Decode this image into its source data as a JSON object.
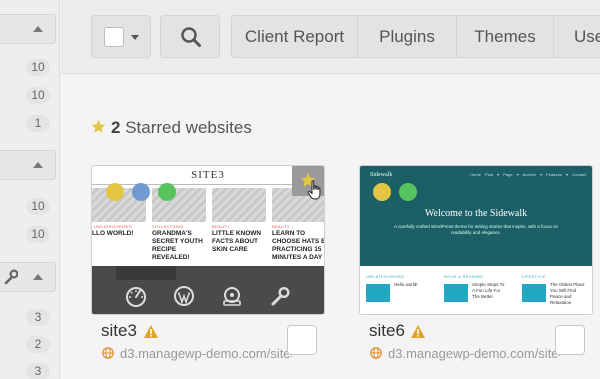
{
  "sidebar": {
    "groups": [
      {
        "counts": [
          "10",
          "10",
          "1"
        ]
      },
      {
        "counts": [
          "10",
          "10"
        ]
      },
      {
        "counts": [
          "3",
          "2",
          "3"
        ]
      }
    ]
  },
  "toolbar": {
    "client_report_label": "Client Report",
    "plugins_label": "Plugins",
    "themes_label": "Themes",
    "users_label": "Use"
  },
  "starred": {
    "count": "2",
    "label": "Starred websites"
  },
  "sites": [
    {
      "name": "site3",
      "url": "d3.managewp-demo.com/site3",
      "thumbnail": {
        "title": "SITE3",
        "posts": [
          {
            "category": "UNCATEGORIZED",
            "title": "LLO WORLD!"
          },
          {
            "category": "COLLECTIONS",
            "title": "GRANDMA'S SECRET YOUTH RECIPE REVEALED!"
          },
          {
            "category": "BEAUTY",
            "title": "LITTLE KNOWN FACTS ABOUT SKIN CARE"
          },
          {
            "category": "BEAUTY",
            "title": "LEARN TO CHOOSE HATS BY PRACTICING 15 MINUTES A DAY"
          }
        ]
      }
    },
    {
      "name": "site6",
      "url": "d3.managewp-demo.com/site6",
      "thumbnail": {
        "logo": "Sidewalk",
        "nav": "Home Post ▾ Page ▾ Archive ▾ Features ▾ Contact",
        "welcome": "Welcome to the Sidewalk",
        "tagline": "A carefully crafted WordPress theme for writing stories that inspire, with a focus on readability and elegance.",
        "columns": [
          {
            "heading": "UNCATEGORIZED",
            "title": "Hello world!"
          },
          {
            "heading": "BOOK & REVIEWS",
            "title": "Simple Steps To A Fun Life For The Better"
          },
          {
            "heading": "LIFESTYLE",
            "title": "The Oldest Place You Will Find Peace and Relaxation"
          }
        ]
      }
    }
  ],
  "colors": {
    "star": "#e3c644",
    "warning": "#e0a32b",
    "globe": "#e08a2a",
    "tag_yellow": "#e3c644",
    "tag_blue": "#6f9bd2",
    "tag_green": "#56c35d",
    "sidewalk_teal": "#1d5f67"
  },
  "icons": {
    "toolbar": [
      "checkbox-icon",
      "caret-down-icon",
      "search-icon"
    ],
    "card_tools": [
      "dashboard-icon",
      "wordpress-icon",
      "backup-icon",
      "wrench-icon"
    ]
  }
}
